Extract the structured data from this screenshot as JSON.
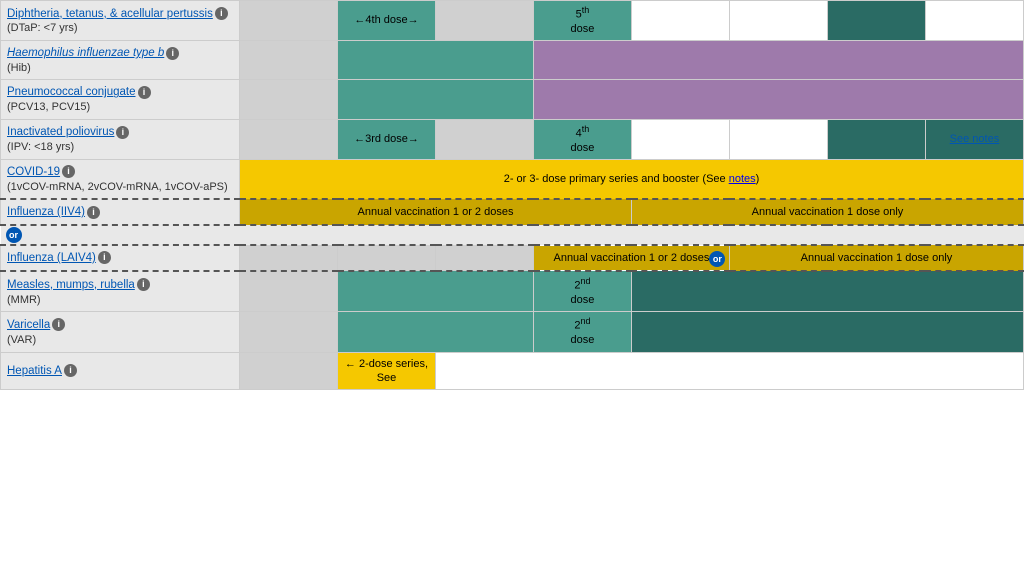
{
  "vaccines": [
    {
      "id": "dtap",
      "name": "Diphtheria, tetanus, & acellular pertussis",
      "link": true,
      "info": true,
      "sub": "(DTaP: <7 yrs)",
      "cells": [
        {
          "colspan": 1,
          "class": "gray-col",
          "text": ""
        },
        {
          "colspan": 1,
          "class": "teal",
          "text": "←4th dose→"
        },
        {
          "colspan": 1,
          "class": "gray-col",
          "text": ""
        },
        {
          "colspan": 1,
          "class": "teal",
          "text": "5th dose",
          "sup": "th",
          "base": "5"
        },
        {
          "colspan": 1,
          "class": "empty",
          "text": ""
        },
        {
          "colspan": 1,
          "class": "empty",
          "text": ""
        },
        {
          "colspan": 1,
          "class": "teal-dark",
          "text": ""
        },
        {
          "colspan": 1,
          "class": "empty",
          "text": ""
        }
      ]
    },
    {
      "id": "hib",
      "name": "Haemophilus influenzae type b",
      "link": true,
      "italic": true,
      "info": true,
      "sub": "(Hib)",
      "cells": [
        {
          "colspan": 1,
          "class": "gray-col",
          "text": ""
        },
        {
          "colspan": 2,
          "class": "teal",
          "text": ""
        },
        {
          "colspan": 5,
          "class": "purple",
          "text": ""
        }
      ]
    },
    {
      "id": "pcv",
      "name": "Pneumococcal conjugate",
      "link": true,
      "info": true,
      "sub": "(PCV13, PCV15)",
      "cells": [
        {
          "colspan": 1,
          "class": "gray-col",
          "text": ""
        },
        {
          "colspan": 2,
          "class": "teal",
          "text": ""
        },
        {
          "colspan": 5,
          "class": "purple",
          "text": ""
        }
      ]
    },
    {
      "id": "ipv",
      "name": "Inactivated poliovirus",
      "link": true,
      "info": true,
      "sub": "(IPV: <18 yrs)",
      "cells": [
        {
          "colspan": 1,
          "class": "gray-col",
          "text": ""
        },
        {
          "colspan": 1,
          "class": "teal",
          "text": "←3rd dose→"
        },
        {
          "colspan": 1,
          "class": "gray-col",
          "text": ""
        },
        {
          "colspan": 1,
          "class": "teal",
          "text": "4th dose"
        },
        {
          "colspan": 1,
          "class": "empty",
          "text": ""
        },
        {
          "colspan": 1,
          "class": "empty",
          "text": ""
        },
        {
          "colspan": 1,
          "class": "teal-dark",
          "text": ""
        },
        {
          "colspan": 1,
          "class": "teal-dark",
          "text": "See notes",
          "notes": true
        }
      ]
    },
    {
      "id": "covid",
      "name": "COVID-19",
      "link": true,
      "info": true,
      "sub": "(1vCOV-mRNA, 2vCOV-mRNA, 1vCOV-aPS)",
      "cells": [
        {
          "colspan": 8,
          "class": "yellow",
          "text": "2- or 3- dose primary series and booster (See notes)",
          "notesLink": true
        }
      ]
    },
    {
      "id": "iiv4",
      "name": "Influenza (IIV4)",
      "link": true,
      "info": true,
      "sub": "",
      "dashed": true,
      "cells": [
        {
          "colspan": 4,
          "class": "yellow-dark",
          "text": "Annual vaccination 1 or 2 doses"
        },
        {
          "colspan": 4,
          "class": "yellow-dark",
          "text": "Annual vaccination 1 dose only"
        }
      ]
    },
    {
      "id": "laiv4-or",
      "isOr": true
    },
    {
      "id": "laiv4",
      "name": "Influenza (LAIV4)",
      "link": true,
      "info": true,
      "sub": "",
      "dashed": true,
      "cells": [
        {
          "colspan": 1,
          "class": "gray-col",
          "text": ""
        },
        {
          "colspan": 1,
          "class": "gray-col",
          "text": ""
        },
        {
          "colspan": 1,
          "class": "gray-col",
          "text": ""
        },
        {
          "colspan": 2,
          "class": "yellow-dark",
          "text": "Annual vaccination 1 or 2 doses",
          "orBadge": true
        },
        {
          "colspan": 3,
          "class": "yellow-dark",
          "text": "Annual vaccination 1 dose only"
        }
      ]
    },
    {
      "id": "mmr",
      "name": "Measles, mumps, rubella",
      "link": true,
      "info": true,
      "sub": "(MMR)",
      "cells": [
        {
          "colspan": 1,
          "class": "gray-col",
          "text": ""
        },
        {
          "colspan": 2,
          "class": "teal",
          "text": ""
        },
        {
          "colspan": 1,
          "class": "teal",
          "text": "2nd dose"
        },
        {
          "colspan": 4,
          "class": "teal-dark",
          "text": ""
        }
      ]
    },
    {
      "id": "var",
      "name": "Varicella",
      "link": true,
      "info": true,
      "sub": "(VAR)",
      "cells": [
        {
          "colspan": 1,
          "class": "gray-col",
          "text": ""
        },
        {
          "colspan": 2,
          "class": "teal",
          "text": ""
        },
        {
          "colspan": 1,
          "class": "teal",
          "text": "2nd dose"
        },
        {
          "colspan": 4,
          "class": "teal-dark",
          "text": ""
        }
      ]
    },
    {
      "id": "hepa",
      "name": "Hepatitis A",
      "link": true,
      "info": true,
      "sub": "",
      "cells": [
        {
          "colspan": 1,
          "class": "gray-col",
          "text": ""
        },
        {
          "colspan": 1,
          "class": "yellow",
          "text": "← 2-dose series, See"
        },
        {
          "colspan": 6,
          "class": "empty",
          "text": ""
        }
      ]
    }
  ],
  "labels": {
    "or": "or",
    "see_notes": "notes",
    "info_symbol": "i"
  }
}
